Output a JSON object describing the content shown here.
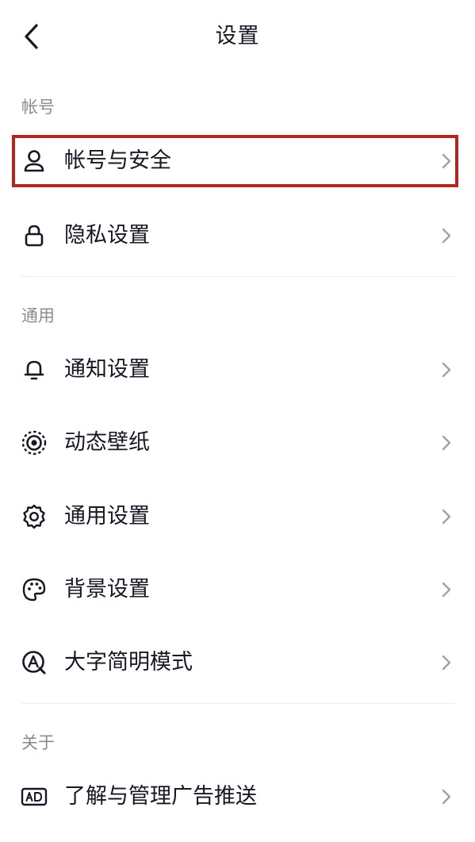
{
  "header": {
    "title": "设置"
  },
  "sections": [
    {
      "label": "帐号",
      "items": [
        {
          "label": "帐号与安全",
          "icon": "person-icon"
        },
        {
          "label": "隐私设置",
          "icon": "lock-icon"
        }
      ]
    },
    {
      "label": "通用",
      "items": [
        {
          "label": "通知设置",
          "icon": "bell-icon"
        },
        {
          "label": "动态壁纸",
          "icon": "live-wallpaper-icon"
        },
        {
          "label": "通用设置",
          "icon": "gear-icon"
        },
        {
          "label": "背景设置",
          "icon": "palette-icon"
        },
        {
          "label": "大字简明模式",
          "icon": "large-text-icon"
        }
      ]
    },
    {
      "label": "关于",
      "items": [
        {
          "label": "了解与管理广告推送",
          "icon": "ad-icon"
        }
      ]
    }
  ],
  "colors": {
    "highlight_border": "#b3261e",
    "section_label": "#8a8b91",
    "text": "#161823",
    "chevron": "#a1a2a7"
  }
}
